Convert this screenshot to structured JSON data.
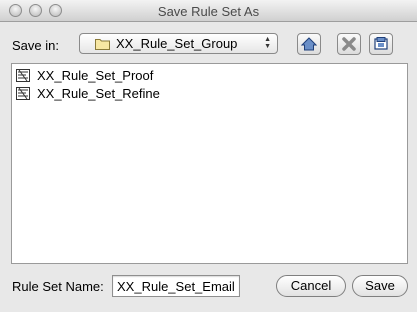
{
  "window": {
    "title": "Save Rule Set As"
  },
  "toolbar": {
    "save_in_label": "Save in:",
    "folder": "XX_Rule_Set_Group",
    "buttons": [
      {
        "icon": "home-icon"
      },
      {
        "icon": "delete-icon"
      },
      {
        "icon": "new-folder-icon"
      }
    ]
  },
  "file_list": {
    "items": [
      {
        "label": "XX_Rule_Set_Proof",
        "icon": "rule-set-file-icon"
      },
      {
        "label": "XX_Rule_Set_Refine",
        "icon": "rule-set-file-icon"
      }
    ]
  },
  "footer": {
    "name_label": "Rule Set Name:",
    "name_value": "XX_Rule_Set_Email",
    "cancel_label": "Cancel",
    "save_label": "Save"
  }
}
